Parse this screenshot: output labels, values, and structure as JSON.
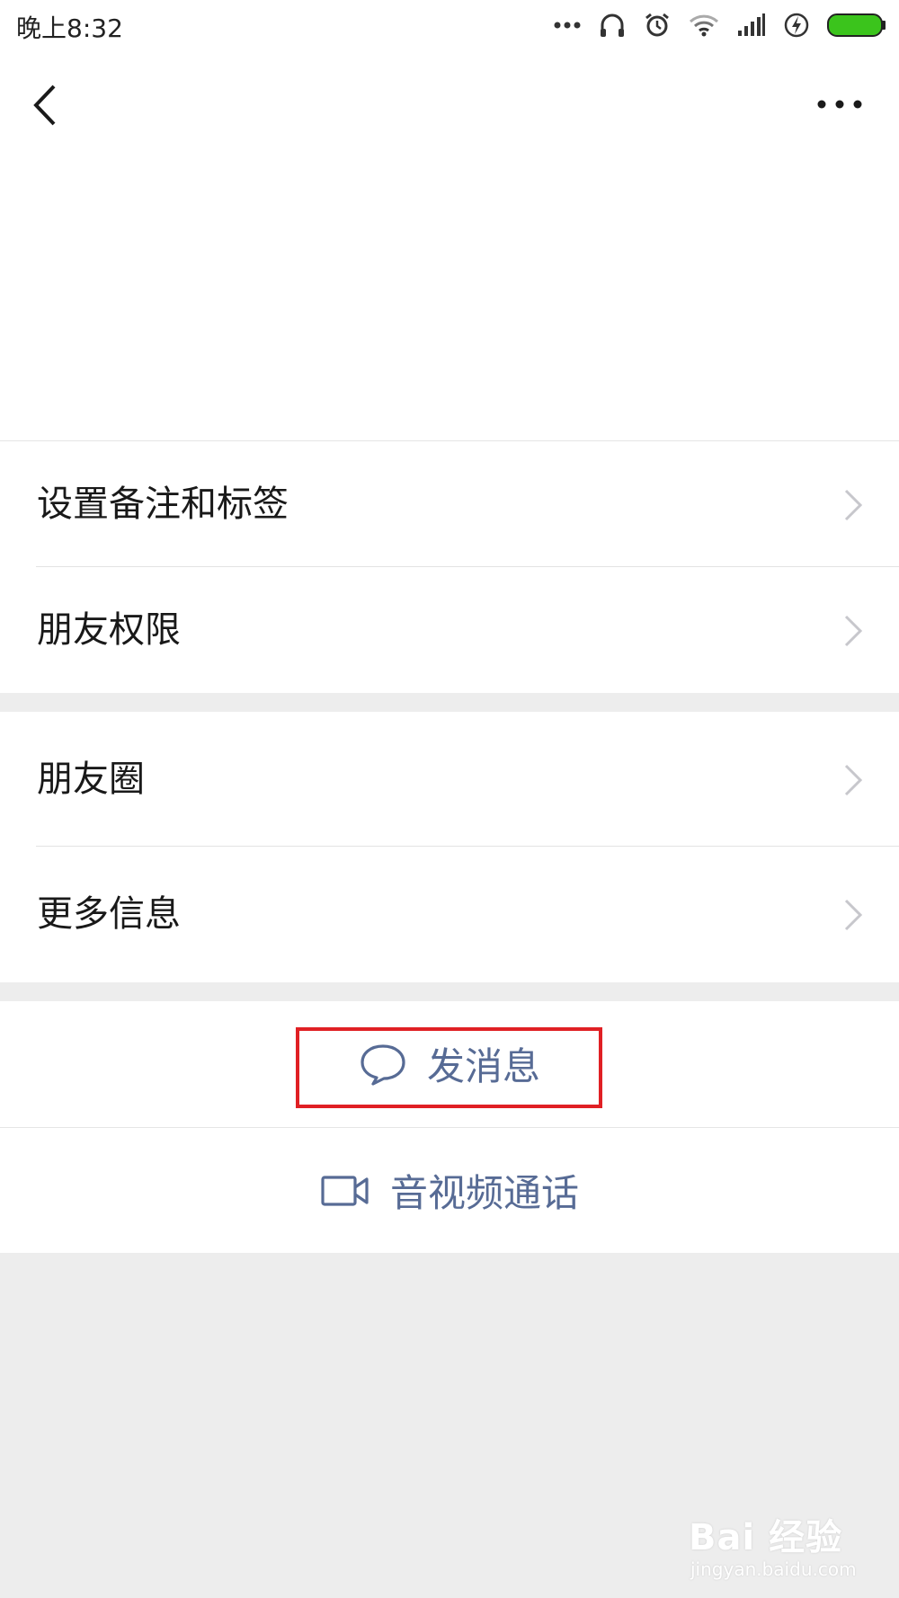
{
  "status_bar": {
    "time": "晚上8:32",
    "icons": [
      "more-dots-icon",
      "headset-icon",
      "alarm-icon",
      "wifi-icon",
      "signal-icon",
      "charging-icon",
      "battery-icon"
    ],
    "battery_color": "#3bc41c"
  },
  "nav": {
    "back_icon": "chevron-left-icon",
    "more_icon": "more-horizontal-icon"
  },
  "group_1": {
    "items": [
      {
        "label": "设置备注和标签"
      },
      {
        "label": "朋友权限"
      }
    ]
  },
  "group_2": {
    "items": [
      {
        "label": "朋友圈"
      },
      {
        "label": "更多信息"
      }
    ]
  },
  "actions": {
    "send_message": {
      "label": "发消息",
      "icon": "chat-bubble-icon"
    },
    "av_call": {
      "label": "音视频通话",
      "icon": "video-camera-icon"
    }
  },
  "highlight_color": "#e02024",
  "accent_color": "#576b95",
  "watermark": {
    "brand": "Bai  经验",
    "site": "jingyan.baidu.com"
  }
}
